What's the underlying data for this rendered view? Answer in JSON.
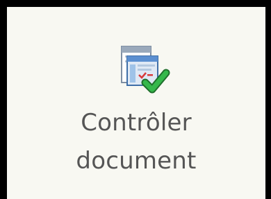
{
  "ribbon": {
    "check_document_button": {
      "label_line1": "Contrôler",
      "label_line2": "document",
      "icon": "document-check-icon"
    }
  },
  "colors": {
    "background": "#f8f8f2",
    "label": "#555555",
    "check_green": "#2c9b3e",
    "frame": "#000000"
  }
}
